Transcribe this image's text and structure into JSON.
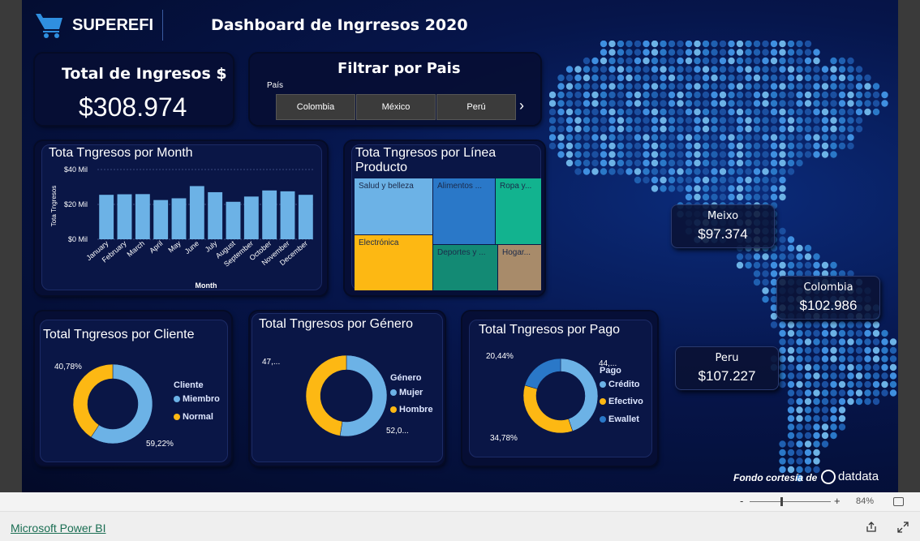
{
  "header": {
    "brand": "SUPEREFI",
    "title": "Dashboard de Ingrresos 2020"
  },
  "total": {
    "title": "Total de Ingresos $",
    "value": "$308.974"
  },
  "filter": {
    "title": "Filtrar por Pais",
    "label": "País",
    "options": [
      "Colombia",
      "México",
      "Perú"
    ],
    "next_icon": "chevron-right-icon"
  },
  "month_chart": {
    "title": "Tota Tngresos por Month",
    "ylabel": "Tota Tngresos",
    "xlabel": "Month",
    "ticks": [
      "$40 Mil",
      "$20 Mil",
      "$0 Mil"
    ],
    "color": "#6cb2e6"
  },
  "treemap": {
    "title_line1": "Tota Tngresos por Línea",
    "title_line2": "Producto",
    "items": [
      {
        "label": "Salud y belleza",
        "color": "#6cb2e6"
      },
      {
        "label": "Alimentos ...",
        "color": "#2a78c8"
      },
      {
        "label": "Ropa y...",
        "color": "#12b38f"
      },
      {
        "label": "Electrónica",
        "color": "#fdb813"
      },
      {
        "label": "Deportes y ...",
        "color": "#138a74"
      },
      {
        "label": "Hogar...",
        "color": "#a88b6a"
      }
    ]
  },
  "cliente": {
    "title": "Total Tngresos por Cliente",
    "legend_title": "Cliente",
    "legend": [
      {
        "label": "Miembro",
        "color": "#6cb2e6"
      },
      {
        "label": "Normal",
        "color": "#fdb813"
      }
    ],
    "label_a": "40,78%",
    "label_b": "59,22%"
  },
  "genero": {
    "title": "Total Tngresos por Género",
    "legend_title": "Género",
    "legend": [
      {
        "label": "Mujer",
        "color": "#6cb2e6"
      },
      {
        "label": "Hombre",
        "color": "#fdb813"
      }
    ],
    "label_a": "47,...",
    "label_b": "52,0..."
  },
  "pago": {
    "title": "Total Tngresos por Pago",
    "legend_title": "Pago",
    "legend": [
      {
        "label": "Crédito",
        "color": "#6cb2e6"
      },
      {
        "label": "Efectivo",
        "color": "#fdb813"
      },
      {
        "label": "Ewallet",
        "color": "#2a78c8"
      }
    ],
    "label_a": "20,44%",
    "label_b": "44,...",
    "label_c": "34,78%"
  },
  "map_cards": [
    {
      "name": "Meixo",
      "value": "$97.374"
    },
    {
      "name": "Colombia",
      "value": "$102.986"
    },
    {
      "name": "Peru",
      "value": "$107.227"
    }
  ],
  "credit": {
    "text": "Fondo cortesía de",
    "brand": "datdata"
  },
  "zoom": {
    "minus": "-",
    "plus": "+",
    "level": "84%"
  },
  "footer": {
    "link": "Microsoft Power BI"
  },
  "chart_data": [
    {
      "type": "bar",
      "title": "Tota Tngresos por Month",
      "xlabel": "Month",
      "ylabel": "Tota Tngresos",
      "categories": [
        "January",
        "February",
        "March",
        "April",
        "May",
        "June",
        "July",
        "August",
        "September",
        "October",
        "November",
        "December"
      ],
      "values": [
        25.5,
        25.8,
        25.9,
        22.5,
        23.5,
        30.5,
        27.0,
        21.5,
        24.5,
        28.0,
        27.5,
        25.5
      ],
      "unit": "Mil",
      "ylim": [
        0,
        40
      ]
    },
    {
      "type": "pie",
      "title": "Total Tngresos por Cliente",
      "categories": [
        "Miembro",
        "Normal"
      ],
      "values": [
        59.22,
        40.78
      ]
    },
    {
      "type": "pie",
      "title": "Total Tngresos por Género",
      "categories": [
        "Mujer",
        "Hombre"
      ],
      "values": [
        52.0,
        47.0
      ]
    },
    {
      "type": "pie",
      "title": "Total Tngresos por Pago",
      "categories": [
        "Crédito",
        "Efectivo",
        "Ewallet"
      ],
      "values": [
        44.78,
        34.78,
        20.44
      ]
    }
  ]
}
